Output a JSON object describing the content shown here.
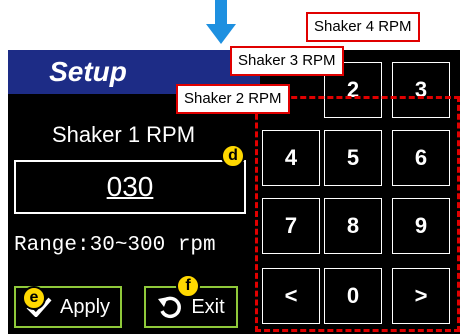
{
  "header": {
    "title": "Setup"
  },
  "shaker": {
    "label": "Shaker 1 RPM",
    "value": "030",
    "range": "Range:30~300 rpm"
  },
  "buttons": {
    "apply": "Apply",
    "exit": "Exit"
  },
  "keypad": {
    "keys": [
      "2",
      "3",
      "4",
      "5",
      "6",
      "7",
      "8",
      "9",
      "<",
      "0",
      ">"
    ]
  },
  "tags": {
    "shaker4": "Shaker 4 RPM",
    "shaker3": "Shaker 3 RPM",
    "shaker2": "Shaker 2 RPM"
  },
  "markers": {
    "d": "d",
    "e": "e",
    "f": "f"
  },
  "colors": {
    "header_bg": "#1d2c86",
    "button_border": "#8fc93a",
    "annotation_red": "#e00000",
    "marker_yellow": "#ffd800",
    "arrow_blue": "#1e90e0"
  }
}
